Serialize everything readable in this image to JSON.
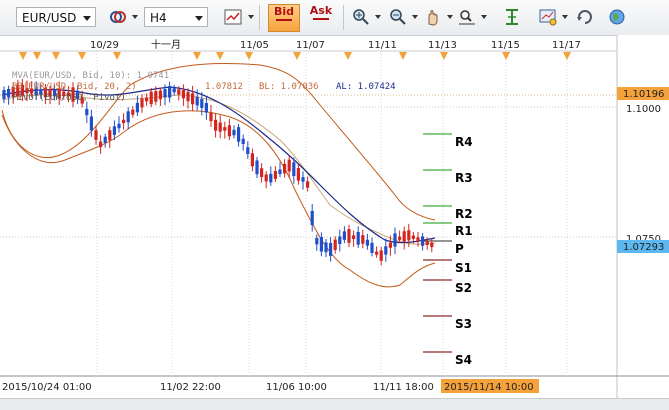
{
  "toolbar": {
    "symbol": "EUR/USD",
    "timeframe": "H4",
    "bid_label": "Bid",
    "ask_label": "Ask"
  },
  "chart_header": {
    "line1": "MVA(EUR/USD, Bid, 10): 1.0741",
    "line2_prefix": "BB(EUR/USD, Bid, 20, 2)",
    "bh_value": "1.07812",
    "bl_label": "BL: 1.07036",
    "al_label": "AL: 1.07424",
    "line3": "PIVOT(EUR/USD, Pivot)"
  },
  "top_axis_labels": [
    "10/29",
    "十一月",
    "11/05",
    "11/07",
    "11/11",
    "11/13",
    "11/15",
    "11/17"
  ],
  "bottom_axis_labels": [
    "2015/10/24  01:00",
    "11/02  22:00",
    "11/06  10:00",
    "11/11  18:00"
  ],
  "cursor_time": "2015/11/14  10:00",
  "price_axis": {
    "labels": [
      "1.1000",
      "1.0750"
    ],
    "top_marker": "1.10196",
    "current_price": "1.07293"
  },
  "pivot_levels": [
    "R4",
    "R3",
    "R2",
    "R1",
    "P",
    "S1",
    "S2",
    "S3",
    "S4"
  ],
  "colors": {
    "bull": "#1f4fc9",
    "bear": "#d3241d",
    "bollinger": "#c25a1a",
    "mva": "#1c2a8a",
    "resistance": "#3eab3e",
    "support": "#8a2a2a",
    "accent": "#f5a23a",
    "current_price_bg": "#5db7f0"
  },
  "icons": [
    "instrument-icon",
    "chart-type-icon",
    "zoom-in-icon",
    "zoom-out-icon",
    "pan-icon",
    "zoom-area-icon",
    "indicators-icon",
    "chart-settings-icon",
    "refresh-icon",
    "globe-icon"
  ]
}
